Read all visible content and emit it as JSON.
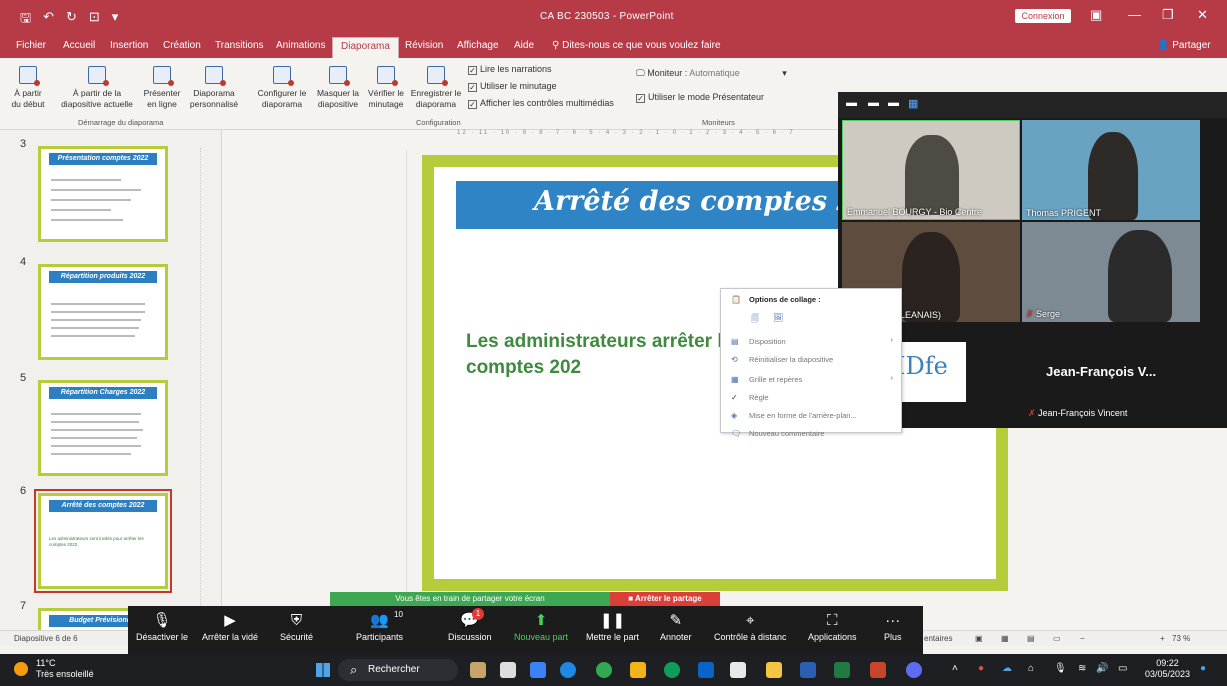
{
  "window": {
    "title": "CA BC 230503 - PowerPoint",
    "connexion": "Connexion",
    "share": "Partager"
  },
  "tabs": [
    "Fichier",
    "Accueil",
    "Insertion",
    "Création",
    "Transitions",
    "Animations",
    "Diaporama",
    "Révision",
    "Affichage",
    "Aide"
  ],
  "tellme": "Dites-nous ce que vous voulez faire",
  "ribbon": {
    "buttons": [
      {
        "label": "À partir\ndu début"
      },
      {
        "label": "À partir de la\ndiapositive actuelle"
      },
      {
        "label": "Présenter\nen ligne"
      },
      {
        "label": "Diaporama\npersonnalisé"
      },
      {
        "label": "Configurer le\ndiaporama"
      },
      {
        "label": "Masquer la\ndiapositive"
      },
      {
        "label": "Vérifier le\nminutage"
      },
      {
        "label": "Enregistrer le\ndiaporama"
      }
    ],
    "group_start": "Démarrage du diaporama",
    "group_config": "Configuration",
    "group_monitors": "Moniteurs",
    "checks": [
      "Lire les narrations",
      "Utiliser le minutage",
      "Afficher les contrôles multimédias"
    ],
    "monitor_label": "Moniteur :",
    "monitor_value": "Automatique",
    "presenter_view": "Utiliser le mode Présentateur"
  },
  "slides": [
    {
      "num": "3",
      "title": "Présentation comptes 2022"
    },
    {
      "num": "4",
      "title": "Répartition produits 2022"
    },
    {
      "num": "5",
      "title": "Répartition Charges 2022"
    },
    {
      "num": "6",
      "title": "Arrêté des comptes 2022",
      "text": "Les administrateurs sont invités pour arrêter les comptes 2022"
    },
    {
      "num": "7",
      "title": "Budget Prévisionnel"
    }
  ],
  "ruler": "12 · 11 · 10 · 9 · 8 · 7 · 6 · 5 · 4 · 3 · 2 · 1 · 0 · 1 · 2 · 3 · 4 · 5 · 6 · 7",
  "main_slide": {
    "title": "Arrêté des comptes 2",
    "body": "Les   administrateurs arrêter les comptes 202"
  },
  "zoom": {
    "participants": [
      {
        "name": "Emmanuel BOURGY - Bio Centre"
      },
      {
        "name": "Thomas PRIGENT"
      },
      {
        "name": "ND (MFR ORLEANAIS)"
      },
      {
        "name": "Serge"
      }
    ],
    "spotlight_name": "Jean-François V...",
    "spotlight_full": "Jean-François Vincent",
    "logo_text": "IDfe"
  },
  "context_menu": {
    "paste_options": "Options de collage :",
    "items": [
      "Disposition",
      "Réinitialiser la diapositive",
      "Grille et repères",
      "Règle",
      "Mise en forme de l'arrière-plan...",
      "Nouveau commentaire"
    ]
  },
  "statusbar": {
    "slide_info": "Diapositive 6 de 6",
    "comments": "entaires",
    "zoom_level": "73 %"
  },
  "sharing": {
    "notice": "Vous êtes en train de partager votre écran",
    "stop": "Arrêter le partage"
  },
  "zoom_toolbar": [
    {
      "label": "Désactiver le",
      "icon": "mic-icon",
      "glyph": "🎙"
    },
    {
      "label": "Arrêter la vidé",
      "icon": "video-icon",
      "glyph": "▶"
    },
    {
      "label": "Sécurité",
      "icon": "shield-icon",
      "glyph": "⛨"
    },
    {
      "label": "Participants",
      "icon": "participants-icon",
      "glyph": "👥",
      "count": "10"
    },
    {
      "label": "Discussion",
      "icon": "chat-icon",
      "glyph": "💬",
      "badge": "1"
    },
    {
      "label": "Nouveau part",
      "icon": "share-icon",
      "glyph": "⬆"
    },
    {
      "label": "Mettre le part",
      "icon": "pause-icon",
      "glyph": "❚❚"
    },
    {
      "label": "Annoter",
      "icon": "pen-icon",
      "glyph": "✎"
    },
    {
      "label": "Contrôle à distanc",
      "icon": "mouse-icon",
      "glyph": "⌖"
    },
    {
      "label": "Applications",
      "icon": "apps-icon",
      "glyph": "⛶"
    },
    {
      "label": "Plus",
      "icon": "more-icon",
      "glyph": "···"
    }
  ],
  "taskbar": {
    "temp": "11°C",
    "weather": "Très ensoleillé",
    "search": "Rechercher",
    "time": "09:22",
    "date": "03/05/2023"
  },
  "colors": {
    "accent": "#b73b47",
    "slide_border": "#b6cc3a",
    "slide_banner": "#2e84c4",
    "slide_text": "#3f8a3f"
  }
}
